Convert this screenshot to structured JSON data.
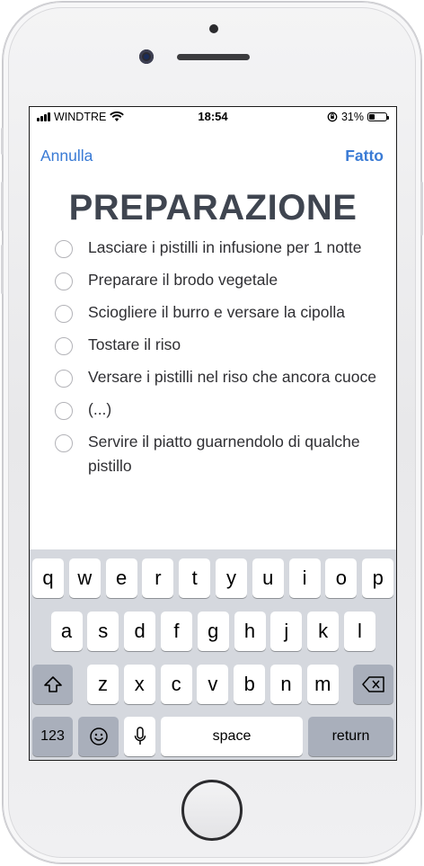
{
  "status_bar": {
    "carrier": "WINDTRE",
    "time": "18:54",
    "battery_percent": "31%",
    "battery_level": 0.31,
    "signal_bars": 4
  },
  "nav": {
    "cancel_label": "Annulla",
    "done_label": "Fatto"
  },
  "title": "PREPARAZIONE",
  "steps": [
    {
      "text": "Lasciare i pistilli in infusione per 1 notte",
      "checked": false
    },
    {
      "text": "Preparare il brodo vegetale",
      "checked": false
    },
    {
      "text": "Sciogliere il burro e versare la cipolla",
      "checked": false
    },
    {
      "text": "Tostare il riso",
      "checked": false
    },
    {
      "text": "Versare i pistilli nel riso che ancora cuoce",
      "checked": false
    },
    {
      "text": "(...)",
      "checked": false
    },
    {
      "text": "Servire il piatto guarnendolo di qualche pistillo",
      "checked": false
    }
  ],
  "keyboard": {
    "row1": [
      "q",
      "w",
      "e",
      "r",
      "t",
      "y",
      "u",
      "i",
      "o",
      "p"
    ],
    "row2": [
      "a",
      "s",
      "d",
      "f",
      "g",
      "h",
      "j",
      "k",
      "l"
    ],
    "row3": [
      "z",
      "x",
      "c",
      "v",
      "b",
      "n",
      "m"
    ],
    "numbers_label": "123",
    "space_label": "space",
    "return_label": "return",
    "icons": [
      "shift-icon",
      "backspace-icon",
      "emoji-icon",
      "microphone-icon"
    ]
  },
  "colors": {
    "accent": "#3a7bd5",
    "title": "#3f4550",
    "keyboard_bg": "#d5d8de"
  }
}
